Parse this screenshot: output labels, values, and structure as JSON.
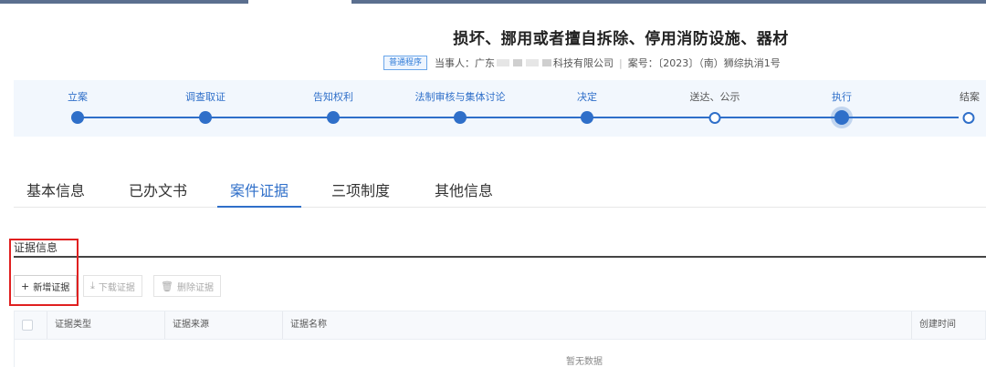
{
  "title": "损坏、挪用或者擅自拆除、停用消防设施、器材",
  "meta": {
    "tag": "普通程序",
    "party_label": "当事人：广东",
    "party_suffix": "科技有限公司",
    "case_label": "案号：〔2023〕（南）狮综执消1号"
  },
  "steps": [
    {
      "label": "立案",
      "state": "done"
    },
    {
      "label": "调查取证",
      "state": "done"
    },
    {
      "label": "告知权利",
      "state": "done"
    },
    {
      "label": "法制审核与集体讨论",
      "state": "done"
    },
    {
      "label": "决定",
      "state": "done"
    },
    {
      "label": "送达、公示",
      "state": "pending"
    },
    {
      "label": "执行",
      "state": "current"
    },
    {
      "label": "结案",
      "state": "pending"
    }
  ],
  "tabs": [
    "基本信息",
    "已办文书",
    "案件证据",
    "三项制度",
    "其他信息"
  ],
  "active_tab": "案件证据",
  "section": {
    "title": "证据信息"
  },
  "toolbar": {
    "add_label": "新增证据",
    "download_label": "下载证据",
    "delete_label": "删除证据"
  },
  "table": {
    "columns": [
      "证据类型",
      "证据来源",
      "证据名称",
      "创建时间"
    ],
    "empty_text": "暂无数据"
  },
  "colors": {
    "accent": "#2f6fc9",
    "highlight": "#e02020"
  }
}
